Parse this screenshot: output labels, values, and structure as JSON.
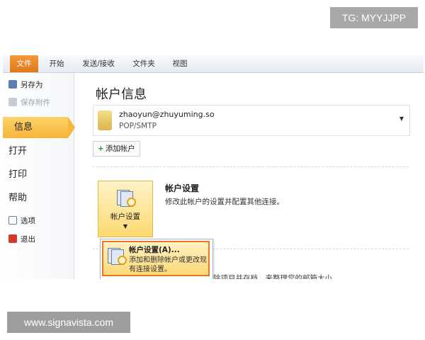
{
  "watermarks": {
    "top": "TG: MYYJJPP",
    "bottom": "www.signavista.com"
  },
  "ribbon": {
    "tabs": [
      {
        "label": "文件"
      },
      {
        "label": "开始"
      },
      {
        "label": "发送/接收"
      },
      {
        "label": "文件夹"
      },
      {
        "label": "视图"
      }
    ]
  },
  "sidebar": {
    "save_as": "另存为",
    "save_attachments": "保存附件",
    "info": "信息",
    "open": "打开",
    "print": "打印",
    "help": "帮助",
    "options": "选项",
    "exit": "退出"
  },
  "main": {
    "title": "帐户信息",
    "account_email": "zhaoyun@zhuyuming.so",
    "account_type": "POP/SMTP",
    "add_account": "添加帐户",
    "settings_button_label": "帐户设置",
    "settings_title": "帐户设置",
    "settings_desc": "修改此帐户的设置并配置其他连接。",
    "dropdown_title": "帐户设置(A)...",
    "dropdown_desc": "添加和删除帐户或更改现有连接设置。",
    "cut_text": "除项目并存档，来整理您的邮箱大小"
  },
  "colors": {
    "file_tab": "#e2761a",
    "selected": "#f7b53a",
    "highlight_border": "#e07a2b"
  }
}
